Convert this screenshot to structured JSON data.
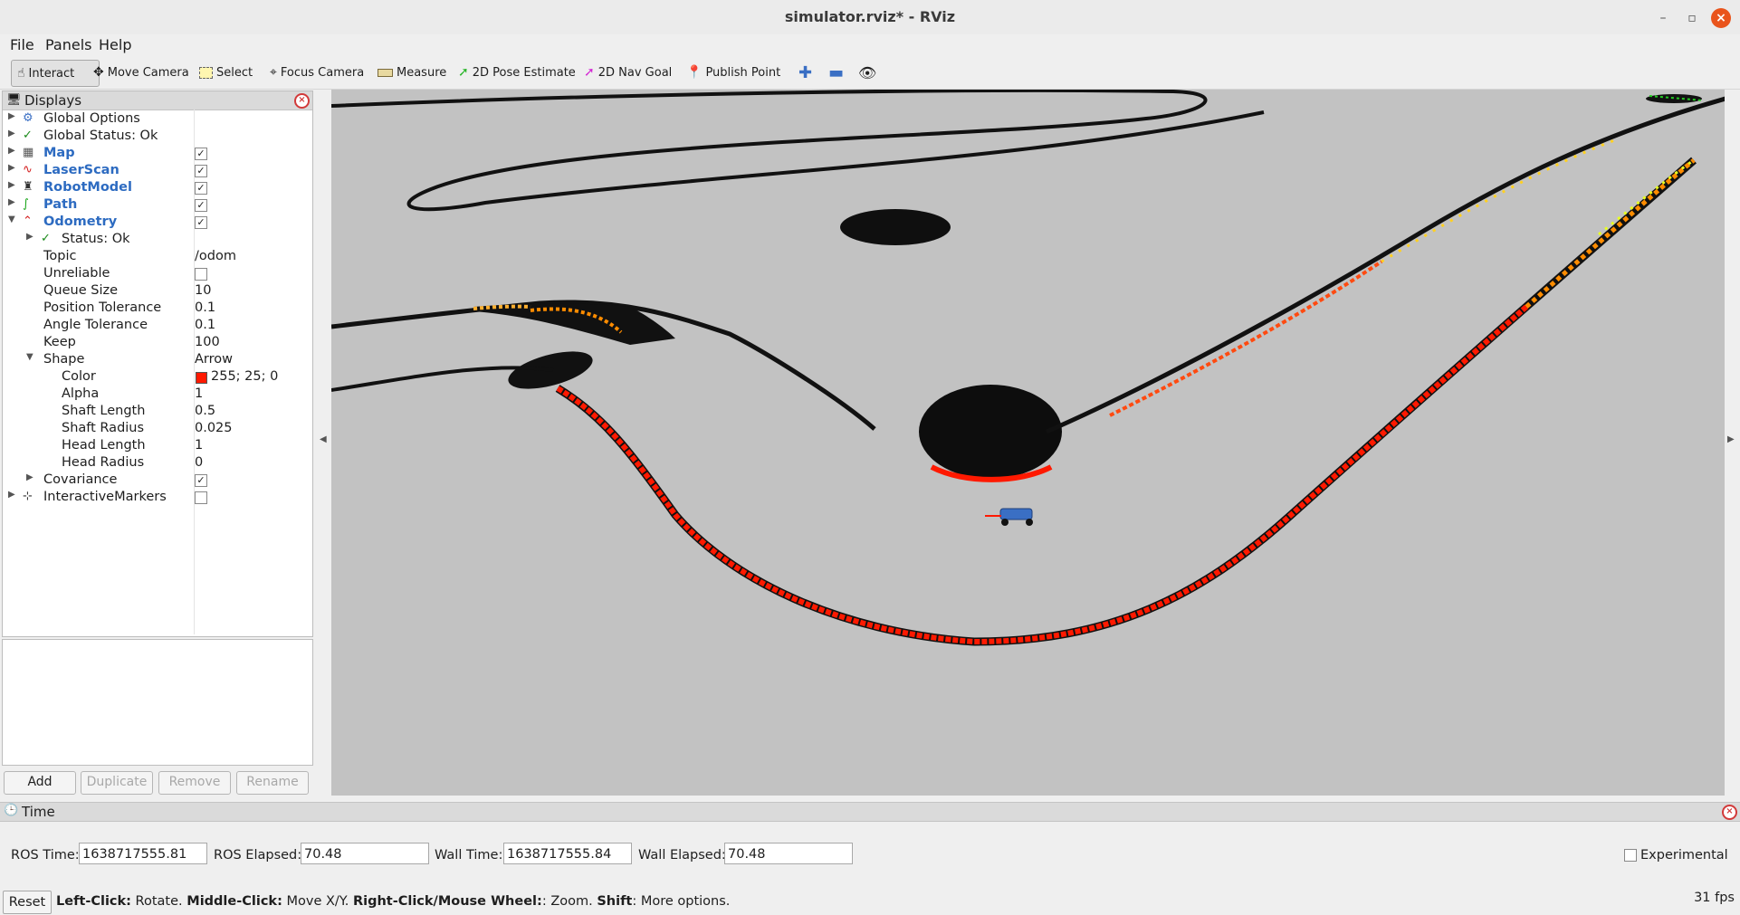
{
  "window": {
    "title": "simulator.rviz* - RViz"
  },
  "menu": {
    "file": "File",
    "panels": "Panels",
    "help": "Help"
  },
  "toolbar": {
    "interact": "Interact",
    "move_camera": "Move Camera",
    "select": "Select",
    "focus_camera": "Focus Camera",
    "measure": "Measure",
    "pose_estimate": "2D Pose Estimate",
    "nav_goal": "2D Nav Goal",
    "publish_point": "Publish Point"
  },
  "displays": {
    "title": "Displays",
    "rows": [
      {
        "label": "Global Options"
      },
      {
        "label": "Global Status: Ok"
      },
      {
        "label": "Map",
        "checked": true
      },
      {
        "label": "LaserScan",
        "checked": true
      },
      {
        "label": "RobotModel",
        "checked": true
      },
      {
        "label": "Path",
        "checked": true
      },
      {
        "label": "Odometry",
        "checked": true
      },
      {
        "label": "Status: Ok"
      },
      {
        "label": "Topic",
        "value": "/odom"
      },
      {
        "label": "Unreliable",
        "checked": false
      },
      {
        "label": "Queue Size",
        "value": "10"
      },
      {
        "label": "Position Tolerance",
        "value": "0.1"
      },
      {
        "label": "Angle Tolerance",
        "value": "0.1"
      },
      {
        "label": "Keep",
        "value": "100"
      },
      {
        "label": "Shape",
        "value": "Arrow"
      },
      {
        "label": "Color",
        "value": "255; 25; 0",
        "swatch": "#ff1900"
      },
      {
        "label": "Alpha",
        "value": "1"
      },
      {
        "label": "Shaft Length",
        "value": "0.5"
      },
      {
        "label": "Shaft Radius",
        "value": "0.025"
      },
      {
        "label": "Head Length",
        "value": "1"
      },
      {
        "label": "Head Radius",
        "value": "0"
      },
      {
        "label": "Covariance",
        "checked": true
      },
      {
        "label": "InteractiveMarkers",
        "checked": false
      }
    ],
    "buttons": {
      "add": "Add",
      "duplicate": "Duplicate",
      "remove": "Remove",
      "rename": "Rename"
    }
  },
  "time": {
    "title": "Time",
    "ros_time_label": "ROS Time:",
    "ros_time": "1638717555.81",
    "ros_elapsed_label": "ROS Elapsed:",
    "ros_elapsed": "70.48",
    "wall_time_label": "Wall Time:",
    "wall_time": "1638717555.84",
    "wall_elapsed_label": "Wall Elapsed:",
    "wall_elapsed": "70.48",
    "experimental": "Experimental"
  },
  "status": {
    "reset": "Reset",
    "help_left": "Left-Click:",
    "help_left_t": " Rotate. ",
    "help_middle": "Middle-Click:",
    "help_middle_t": " Move X/Y. ",
    "help_right": "Right-Click/Mouse Wheel:",
    "help_right_t": ": Zoom. ",
    "help_shift": "Shift",
    "help_shift_t": ": More options.",
    "fps": "31 fps"
  },
  "colors": {
    "laser_near": "#ff1900",
    "laser_far": "#ff8c00",
    "path": "#22cc22",
    "robot": "#3a6fc4"
  }
}
